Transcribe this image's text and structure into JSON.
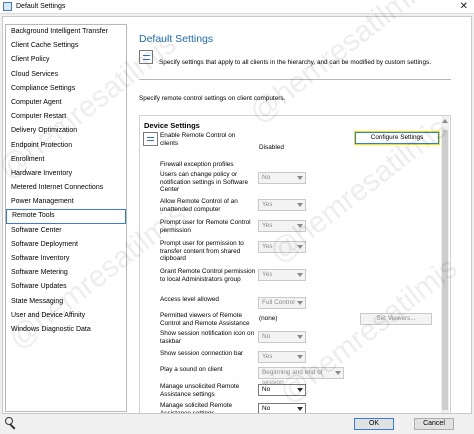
{
  "window": {
    "title": "Default Settings",
    "close_glyph": "✕"
  },
  "sidebar": {
    "items": [
      "Background Intelligent Transfer",
      "Client Cache Settings",
      "Client Policy",
      "Cloud Services",
      "Compliance Settings",
      "Computer Agent",
      "Computer Restart",
      "Delivery Optimization",
      "Endpoint Protection",
      "Enrollment",
      "Hardware Inventory",
      "Metered Internet Connections",
      "Power Management",
      "Remote Tools",
      "Software Center",
      "Software Deployment",
      "Software Inventory",
      "Software Metering",
      "Software Updates",
      "State Messaging",
      "User and Device Affinity",
      "Windows Diagnostic Data"
    ],
    "selected_index": 13
  },
  "main": {
    "heading": "Default Settings",
    "intro": "Specify settings that apply to all clients in the hierarchy, and can be modified by custom settings.",
    "description": "Specify remote control settings on client computers.",
    "group_title": "Device Settings",
    "remote_control": {
      "label": "Enable Remote Control on clients",
      "status": "Disabled",
      "configure_button": "Configure Settings"
    },
    "firewall_label": "Firewall exception profiles",
    "settings": [
      {
        "label": "Users can change policy or notification settings in Software Center",
        "value": "No",
        "enabled": false
      },
      {
        "label": "Allow Remote Control of an unattended computer",
        "value": "Yes",
        "enabled": false
      },
      {
        "label": "Prompt user for Remote Control permission",
        "value": "Yes",
        "enabled": false
      },
      {
        "label": "Prompt user for permission to transfer content from shared clipboard",
        "value": "Yes",
        "enabled": false
      },
      {
        "label": "Grant Remote Control permission to local Administrators group",
        "value": "Yes",
        "enabled": false
      },
      {
        "label": "Access level allowed",
        "value": "Full Control",
        "enabled": false
      },
      {
        "label": "Permitted viewers of Remote Control and Remote Assistance",
        "value": "(none)",
        "button": "Set Viewers..."
      },
      {
        "label": "Show session notification icon on taskbar",
        "value": "No",
        "enabled": false
      },
      {
        "label": "Show session connection bar",
        "value": "Yes",
        "enabled": false
      },
      {
        "label": "Play a sound on client",
        "value": "Beginning and end of session",
        "enabled": false
      },
      {
        "label": "Manage unsolicited Remote Assistance settings",
        "value": "No",
        "enabled": true
      },
      {
        "label": "Manage solicited Remote Assistance settings",
        "value": "No",
        "enabled": true
      }
    ]
  },
  "footer": {
    "ok": "OK",
    "cancel": "Cancel"
  },
  "watermark": "@hemresatilmis",
  "colors": {
    "heading": "#1e6bb0",
    "selection_border": "#3a7bd5",
    "highlight": "#f0e400"
  }
}
